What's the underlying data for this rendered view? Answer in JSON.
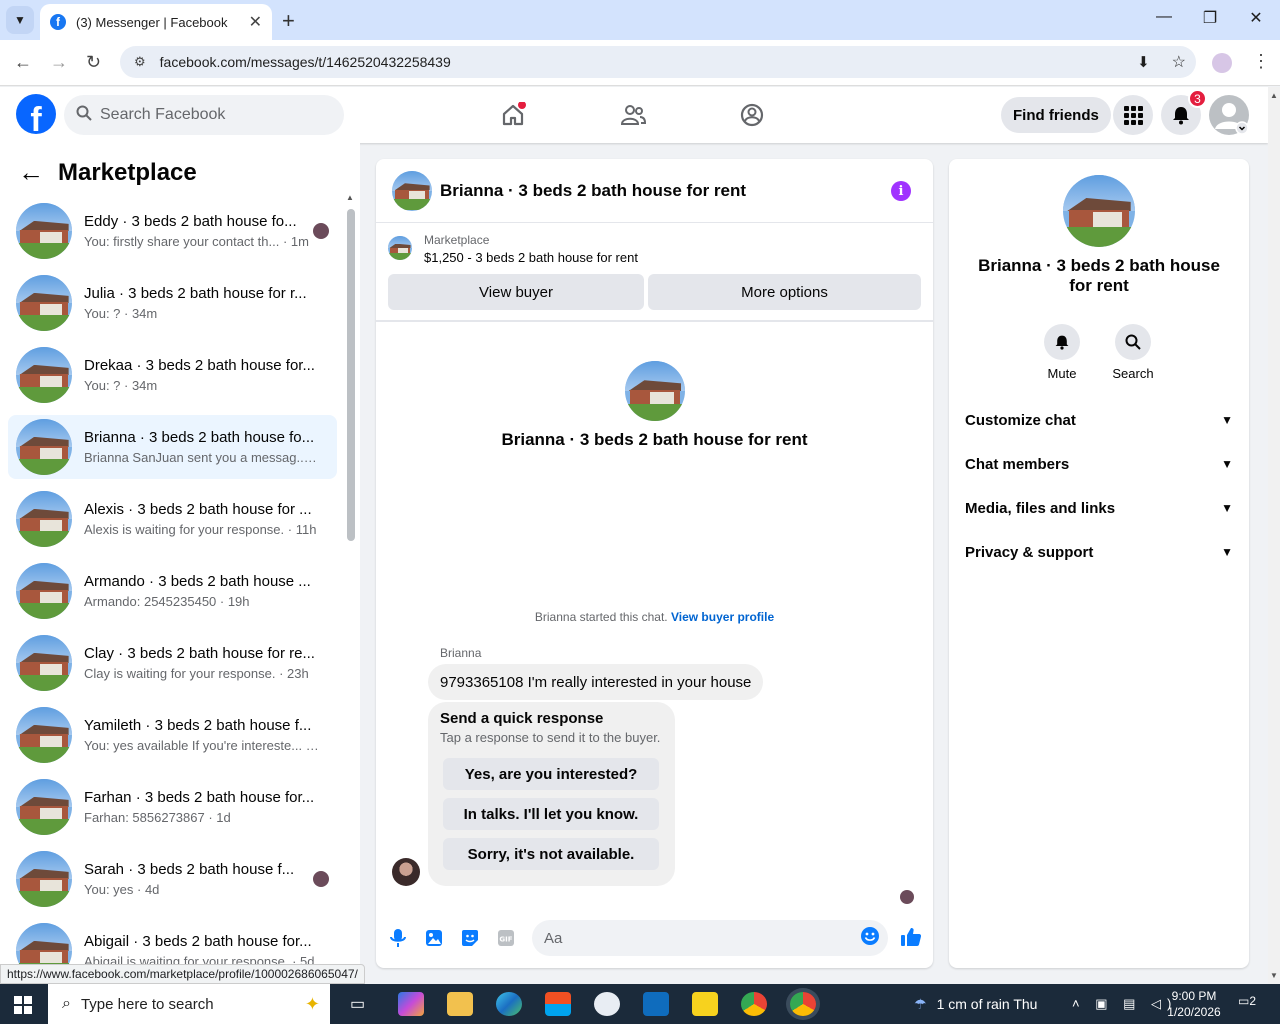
{
  "browser": {
    "tab_title": "(3) Messenger | Facebook",
    "tab_close": "✕",
    "new_tab": "+",
    "url": "facebook.com/messages/t/1462520432258439",
    "status_url": "https://www.facebook.com/marketplace/profile/100002686065047/"
  },
  "header": {
    "search_placeholder": "Search Facebook",
    "find_friends": "Find friends",
    "notifications_count": "3",
    "colors": {
      "brand": "#0866ff",
      "badge": "#e41e3f"
    }
  },
  "sidebar": {
    "title": "Marketplace",
    "conversations": [
      {
        "name": "Eddy · 3 beds 2 bath house fo...",
        "preview": "You: firstly share your contact th... · 1m",
        "seen": true
      },
      {
        "name": "Julia · 3 beds 2 bath house for r...",
        "preview": "You: ? · 34m",
        "seen": false
      },
      {
        "name": "Drekaa · 3 beds 2 bath house for...",
        "preview": "You: ? · 34m",
        "seen": false
      },
      {
        "name": "Brianna · 3 beds 2 bath house fo...",
        "preview": "Brianna SanJuan sent you a messag... · 2h",
        "seen": false,
        "active": true
      },
      {
        "name": "Alexis · 3 beds 2 bath house for ...",
        "preview": "Alexis is waiting for your response. · 11h",
        "seen": false
      },
      {
        "name": "Armando · 3 beds 2 bath house ...",
        "preview": "Armando: 2545235450 · 19h",
        "seen": false
      },
      {
        "name": "Clay · 3 beds 2 bath house for re...",
        "preview": "Clay is waiting for your response. · 23h",
        "seen": false
      },
      {
        "name": "Yamileth · 3 beds 2 bath house f...",
        "preview": "You: yes available If you're intereste... · 1d",
        "seen": false
      },
      {
        "name": "Farhan · 3 beds 2 bath house for...",
        "preview": "Farhan: 5856273867 · 1d",
        "seen": false
      },
      {
        "name": "Sarah · 3 beds 2 bath house f...",
        "preview": "You: yes · 4d",
        "seen": true
      },
      {
        "name": "Abigail · 3 beds 2 bath house for...",
        "preview": "Abigail is waiting for your response. · 5d",
        "seen": false
      }
    ]
  },
  "chat": {
    "title": "Brianna · 3 beds 2 bath house for rent",
    "info_glyph": "i",
    "marketplace_label": "Marketplace",
    "listing": "$1,250 - 3 beds 2 bath house for rent",
    "view_buyer": "View buyer",
    "more_options": "More options",
    "center_title": "Brianna · 3 beds 2 bath house for rent",
    "started_text": "Brianna started this chat.",
    "view_buyer_profile": "View buyer profile",
    "sender_name": "Brianna",
    "message": "9793365108 I'm really interested in your house",
    "quick_title": "Send a quick response",
    "quick_sub": "Tap a response to send it to the buyer.",
    "quick_responses": [
      "Yes, are you interested?",
      "In talks. I'll let you know.",
      "Sorry, it's not available."
    ],
    "input_placeholder": "Aa",
    "accent_color": "#0a7cff"
  },
  "details": {
    "title": "Brianna · 3 beds 2 bath house for rent",
    "mute": "Mute",
    "search": "Search",
    "sections": [
      "Customize chat",
      "Chat members",
      "Media, files and links",
      "Privacy & support"
    ]
  },
  "taskbar": {
    "search_placeholder": "Type here to search",
    "weather": "1 cm of rain Thu",
    "time": "9:00 PM",
    "date": "1/20/2026",
    "notifications": "2"
  }
}
